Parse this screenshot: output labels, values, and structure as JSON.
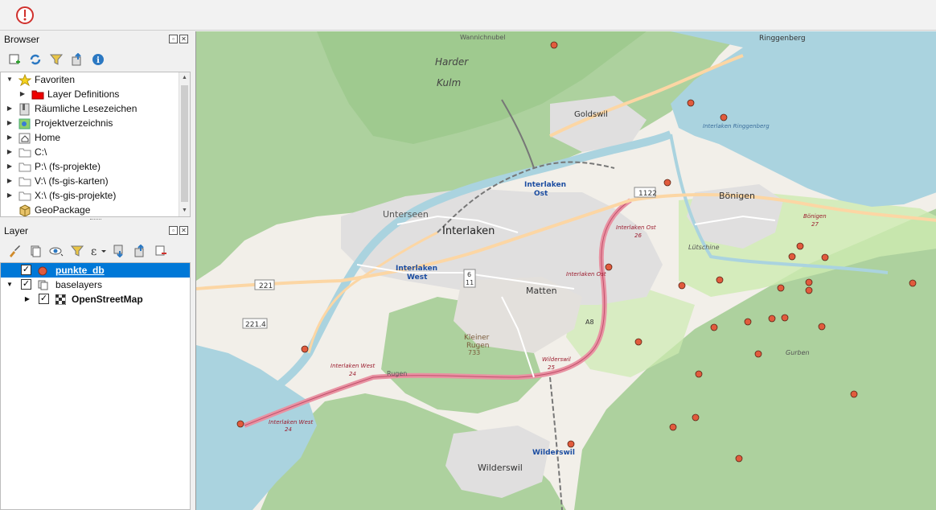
{
  "browser_panel": {
    "title": "Browser",
    "items": [
      {
        "label": "Favoriten",
        "icon": "star-icon",
        "expanded": true
      },
      {
        "label": "Layer Definitions",
        "icon": "red-folder-icon",
        "expanded": false
      },
      {
        "label": "Räumliche Lesezeichen",
        "icon": "bookmark-icon",
        "expanded": false
      },
      {
        "label": "Projektverzeichnis",
        "icon": "project-icon",
        "expanded": false
      },
      {
        "label": "Home",
        "icon": "home-icon",
        "expanded": false
      },
      {
        "label": "C:\\",
        "icon": "folder-icon",
        "expanded": false
      },
      {
        "label": "P:\\ (fs-projekte)",
        "icon": "folder-icon",
        "expanded": false
      },
      {
        "label": "V:\\ (fs-gis-karten)",
        "icon": "folder-icon",
        "expanded": false
      },
      {
        "label": "X:\\ (fs-gis-projekte)",
        "icon": "folder-icon",
        "expanded": false
      },
      {
        "label": "GeoPackage",
        "icon": "geopackage-icon",
        "expanded": false
      }
    ]
  },
  "layer_panel": {
    "title": "Layer",
    "layers": [
      {
        "label": "punkte_db",
        "checked": true,
        "selected": true,
        "icon": "point-layer-icon"
      },
      {
        "label": "baselayers",
        "checked": true,
        "selected": false,
        "icon": "group-icon"
      },
      {
        "label": "OpenStreetMap",
        "checked": true,
        "selected": false,
        "icon": "raster-icon"
      }
    ]
  },
  "map": {
    "labels": {
      "harder": "Harder",
      "kulm": "Kulm",
      "wannichnubel": "Wannichnubel",
      "ringgenberg": "Ringgenberg",
      "goldswil": "Goldswil",
      "interlaken_ost": "Interlaken",
      "interlaken_ost2": "Ost",
      "boenigen": "Bönigen",
      "unterseen": "Unterseen",
      "interlaken": "Interlaken",
      "interlaken_west": "Interlaken",
      "interlaken_west2": "West",
      "matten": "Matten",
      "kleiner_rugen": "Kleiner",
      "kleiner_rugen2": "Rugen",
      "rugen_height": "733",
      "wilderswil": "Wilderswil",
      "wilderswil_station": "Wilderswil",
      "rugen": "Rugen",
      "road_1122": "1122",
      "road_221": "221",
      "road_2214": "221.4",
      "road_6": "6",
      "road_11": "11",
      "a8": "A8",
      "exit_ost": "Interlaken Ost",
      "exit_ost_num": "26",
      "exit_wilderswil": "Wilderswil",
      "exit_wilderswil_num": "25",
      "exit_west": "Interlaken West",
      "exit_west_num": "24",
      "exit_gunten": "Interlaken West",
      "exit_gunten_num": "24",
      "exit_boenigen": "Bönigen",
      "exit_boenigen_num": "27",
      "luetschine": "Lütschine",
      "guerbe": "Gurben",
      "interlaken_ost_label": "Interlaken Ost",
      "brienzersee": "Interlaken Ringgenberg"
    },
    "colors": {
      "forest": "#add19e",
      "water": "#aad3df",
      "urban": "#e0dfdf",
      "motorway": "#e892a2",
      "primary": "#fcd6a4",
      "point": "#e15b3d"
    },
    "points": [
      {
        "lon": 445,
        "lat": 17
      },
      {
        "lon": 615,
        "lat": 89
      },
      {
        "lon": 656,
        "lat": 107
      },
      {
        "lon": 586,
        "lat": 188
      },
      {
        "lon": 513,
        "lat": 293
      },
      {
        "lon": 751,
        "lat": 267
      },
      {
        "lon": 782,
        "lat": 281
      },
      {
        "lon": 741,
        "lat": 280
      },
      {
        "lon": 651,
        "lat": 309
      },
      {
        "lon": 604,
        "lat": 316
      },
      {
        "lon": 727,
        "lat": 319
      },
      {
        "lon": 762,
        "lat": 322
      },
      {
        "lon": 891,
        "lat": 313
      },
      {
        "lon": 762,
        "lat": 312
      },
      {
        "lon": 716,
        "lat": 357
      },
      {
        "lon": 686,
        "lat": 361
      },
      {
        "lon": 732,
        "lat": 356
      },
      {
        "lon": 778,
        "lat": 367
      },
      {
        "lon": 644,
        "lat": 368
      },
      {
        "lon": 550,
        "lat": 386
      },
      {
        "lon": 699,
        "lat": 401
      },
      {
        "lon": 625,
        "lat": 426
      },
      {
        "lon": 818,
        "lat": 451
      },
      {
        "lon": 621,
        "lat": 480
      },
      {
        "lon": 593,
        "lat": 492
      },
      {
        "lon": 466,
        "lat": 513
      },
      {
        "lon": 675,
        "lat": 531
      },
      {
        "lon": 135,
        "lat": 395
      },
      {
        "lon": 55,
        "lat": 488
      }
    ]
  }
}
